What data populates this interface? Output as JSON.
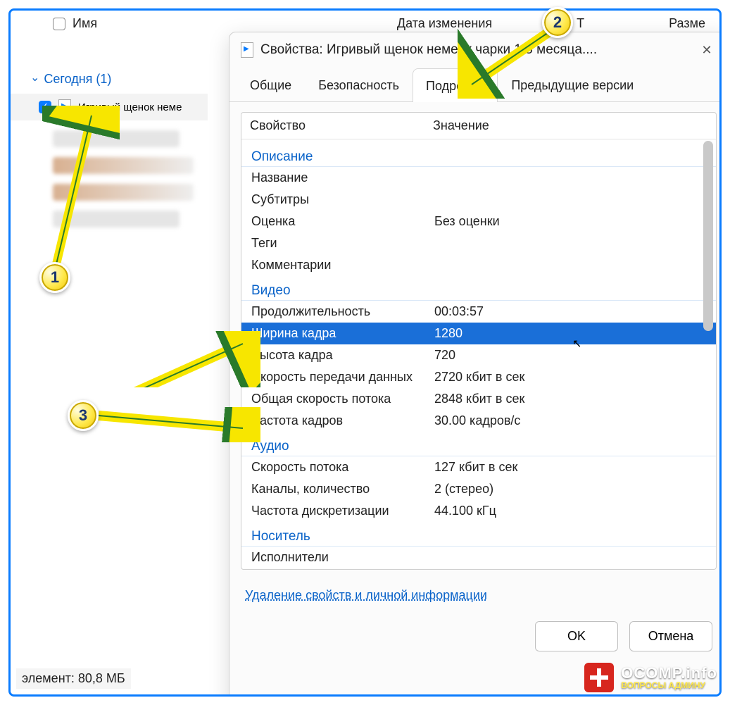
{
  "explorer": {
    "columns": {
      "name": "Имя",
      "modified": "Дата изменения",
      "type": "Т",
      "size": "Разме"
    },
    "group": "Сегодня (1)",
    "selected_file": "Игривый щенок неме",
    "status": "элемент: 80,8 МБ"
  },
  "dialog": {
    "title": "Свойства: Игривый щенок немецк           чарки 1.5 месяца....",
    "tabs": {
      "general": "Общие",
      "security": "Безопасность",
      "details": "Подробно",
      "previous": "Предыдущие версии"
    },
    "headers": {
      "prop": "Свойство",
      "val": "Значение"
    },
    "sections": {
      "description": "Описание",
      "video": "Видео",
      "audio": "Аудио",
      "media": "Носитель"
    },
    "props": {
      "title_k": "Название",
      "title_v": "",
      "subtitles_k": "Субтитры",
      "subtitles_v": "",
      "rating_k": "Оценка",
      "rating_v": "Без оценки",
      "tags_k": "Теги",
      "tags_v": "",
      "comments_k": "Комментарии",
      "comments_v": "",
      "duration_k": "Продолжительность",
      "duration_v": "00:03:57",
      "framewidth_k": "Ширина кадра",
      "framewidth_v": "1280",
      "frameheight_k": "Высота кадра",
      "frameheight_v": "720",
      "bitrate_k": "Скорость передачи данных",
      "bitrate_v": "2720 кбит в сек",
      "totalbitrate_k": "Общая скорость потока",
      "totalbitrate_v": "2848 кбит в сек",
      "framerate_k": "Частота кадров",
      "framerate_v": "30.00 кадров/с",
      "audiobitrate_k": "Скорость потока",
      "audiobitrate_v": "127 кбит в сек",
      "channels_k": "Каналы, количество",
      "channels_v": "2 (стерео)",
      "samplerate_k": "Частота дискретизации",
      "samplerate_v": "44.100 кГц",
      "performers_k": "Исполнители",
      "performers_v": ""
    },
    "link": "Удаление свойств и личной информации",
    "buttons": {
      "ok": "OK",
      "cancel": "Отмена"
    }
  },
  "badges": {
    "b1": "1",
    "b2": "2",
    "b3": "3"
  },
  "watermark": {
    "line1": "OCOMP.info",
    "line2": "ВОПРОСЫ АДМИНУ"
  }
}
